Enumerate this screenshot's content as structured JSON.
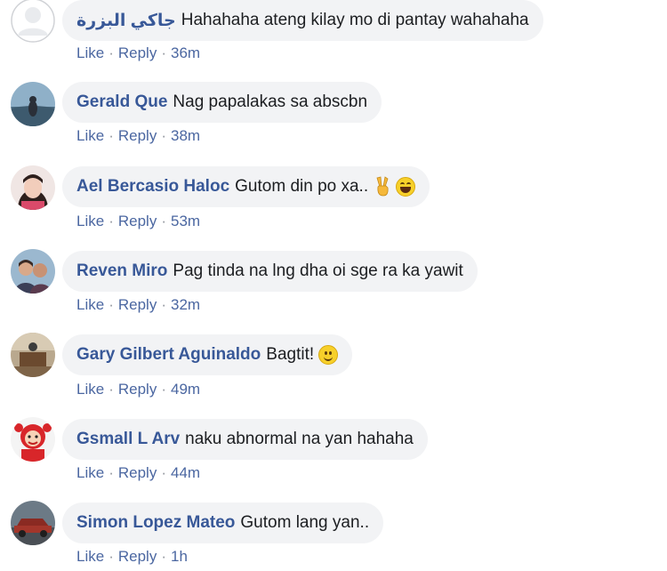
{
  "actions": {
    "like": "Like",
    "reply": "Reply",
    "separator": "·"
  },
  "comments": [
    {
      "author": "جاكي البزرة",
      "text": "Hahahaha ateng kilay mo di pantay wahahaha",
      "time": "36m",
      "avatar": "default-avatar"
    },
    {
      "author": "Gerald Que",
      "text": "Nag papalakas sa abscbn",
      "time": "38m",
      "avatar": "landscape-avatar"
    },
    {
      "author": "Ael Bercasio Haloc",
      "text": "Gutom din po xa..",
      "time": "53m",
      "avatar": "woman-avatar",
      "emoji": [
        "victory-hand-icon",
        "laughing-face-icon"
      ]
    },
    {
      "author": "Reven Miro",
      "text": "Pag tinda na lng dha oi sge ra ka yawit",
      "time": "32m",
      "avatar": "group-avatar"
    },
    {
      "author": "Gary Gilbert Aguinaldo",
      "text": "Bagtit!",
      "time": "49m",
      "avatar": "room-avatar",
      "emoji": [
        "smiling-face-icon"
      ]
    },
    {
      "author": "Gsmall L Arv",
      "text": "naku abnormal na yan hahaha",
      "time": "44m",
      "avatar": "mascot-avatar"
    },
    {
      "author": "Simon Lopez Mateo",
      "text": "Gutom lang yan..",
      "time": "1h",
      "avatar": "car-avatar"
    }
  ],
  "colors": {
    "author": "#385898",
    "bubble": "#f2f3f5",
    "action_link": "#4b67a1"
  }
}
